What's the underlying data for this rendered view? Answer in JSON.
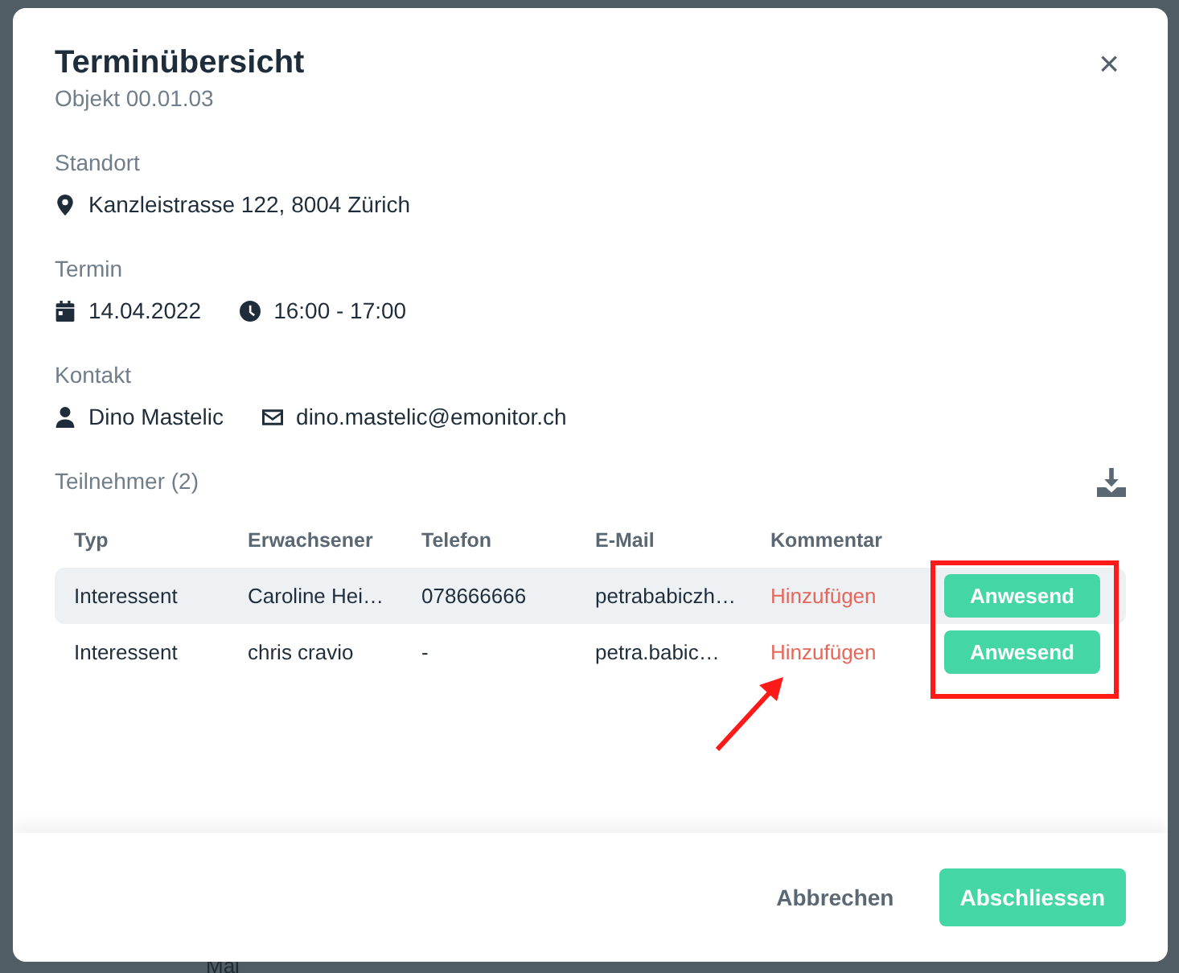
{
  "background": {
    "label": "Mai"
  },
  "dialog": {
    "title": "Terminübersicht",
    "subtitle": "Objekt 00.01.03",
    "close": "×"
  },
  "sections": [
    {
      "label": "Standort",
      "items": [
        {
          "kind": "address",
          "text": "Kanzleistrasse 122, 8004 Zürich"
        }
      ]
    },
    {
      "label": "Termin",
      "items": [
        {
          "kind": "date",
          "text": "14.04.2022"
        },
        {
          "kind": "time",
          "text": "16:00 - 17:00"
        }
      ]
    },
    {
      "label": "Kontakt",
      "items": [
        {
          "kind": "person",
          "text": "Dino Mastelic"
        },
        {
          "kind": "email",
          "text": "dino.mastelic@emonitor.ch"
        }
      ]
    }
  ],
  "participants": {
    "label": "Teilnehmer (2)",
    "columns": [
      "Typ",
      "Erwachsener",
      "Telefon",
      "E-Mail",
      "Kommentar"
    ],
    "rows": [
      {
        "highlighted": true,
        "cells": [
          "Interessent",
          "Caroline Hei…",
          "078666666",
          "petrababiczh…"
        ],
        "comment": "Hinzufügen",
        "action": "Anwesend"
      },
      {
        "highlighted": false,
        "cells": [
          "Interessent",
          "chris cravio",
          "-",
          "petra.babic…"
        ],
        "comment": "Hinzufügen",
        "action": "Anwesend"
      }
    ]
  },
  "annotations": {
    "frame": true,
    "arrow": true
  },
  "footer": {
    "cancel": "Abbrechen",
    "confirm": "Abschliessen"
  }
}
